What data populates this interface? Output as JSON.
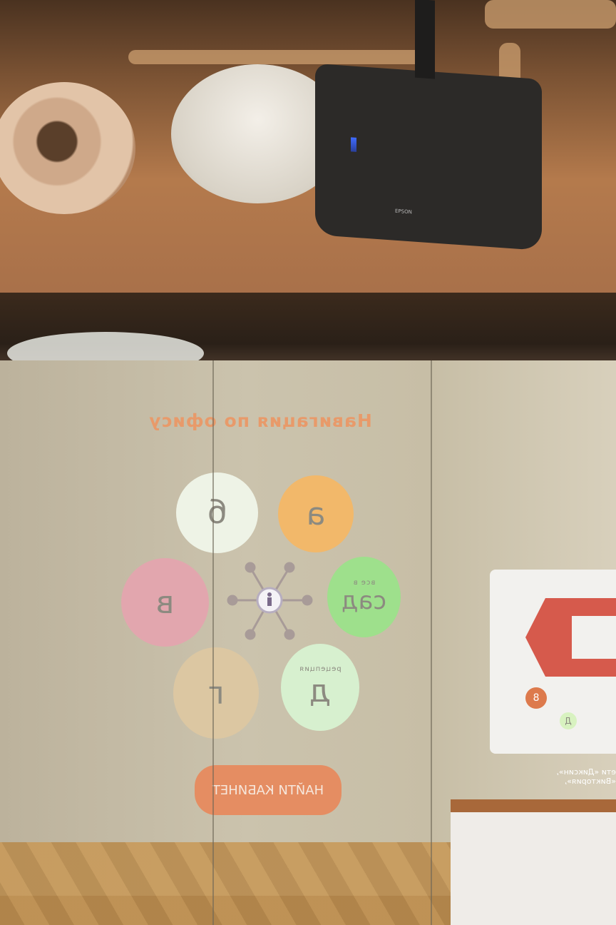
{
  "projector": {
    "brand": "EPSON"
  },
  "screen": {
    "title": "Навигация по офису",
    "zones": [
      {
        "letter": "б",
        "color": "#eef3e6"
      },
      {
        "letter": "а",
        "color": "#f2b86a"
      },
      {
        "letter": "в",
        "color": "#e2a6ae"
      },
      {
        "letter": "сад",
        "caption": "все в",
        "color": "#9ee08c"
      },
      {
        "letter": "г",
        "color": "#dcc7a2"
      },
      {
        "letter": "д",
        "caption": "рецепция",
        "color": "#d7f0cf"
      }
    ],
    "find_button": "НАЙТИ КАБИНЕТ",
    "side_panel": {
      "badge": "8",
      "zone_label": "Д",
      "text": "ети «Диксин», «Виктория», "
    }
  }
}
